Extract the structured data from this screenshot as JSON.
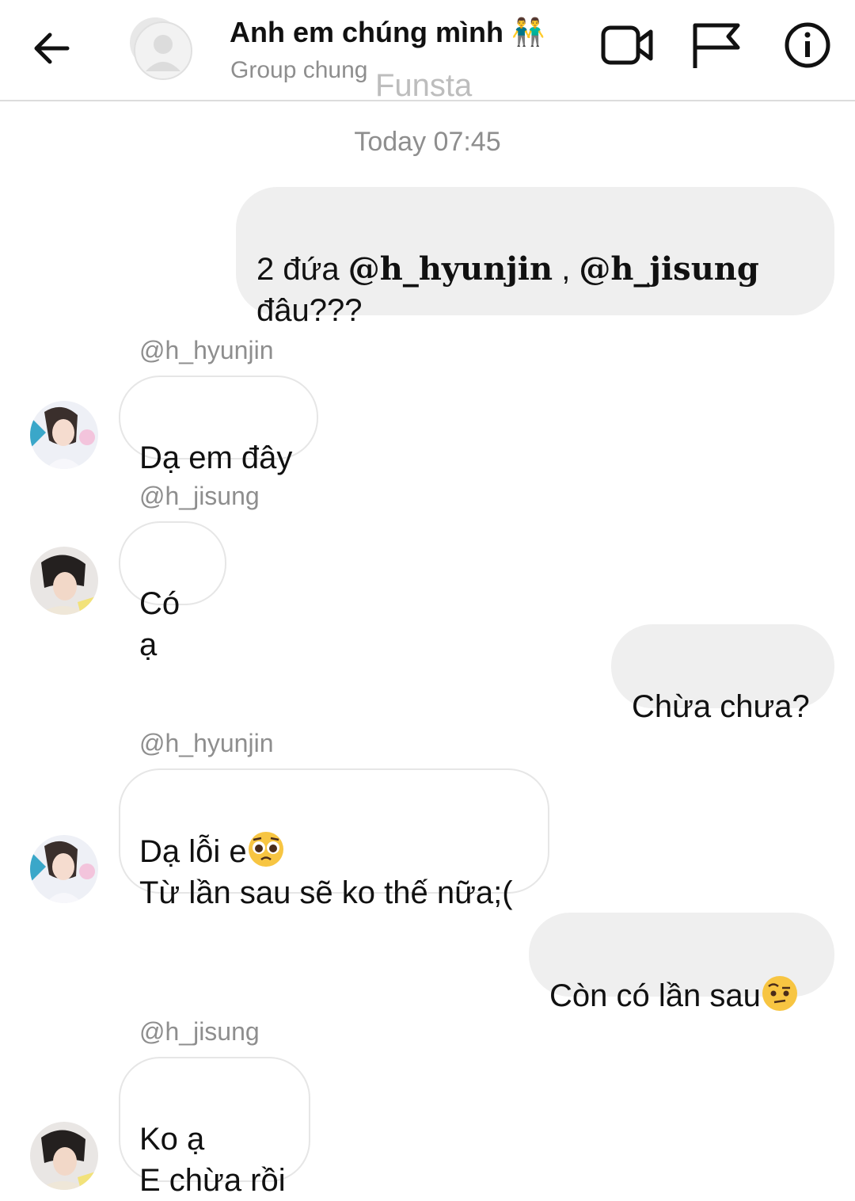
{
  "header": {
    "title": "Anh em chúng mình",
    "title_emoji": "👬",
    "subtitle": "Group chung",
    "watermark": "Funsta",
    "icons": [
      "back-arrow-icon",
      "group-avatar-icon",
      "video-call-icon",
      "flag-icon",
      "info-icon"
    ]
  },
  "chat": {
    "timestamp": "Today 07:45",
    "messages": [
      {
        "direction": "out",
        "text_before": "2 đứa ",
        "mention1": "@h_hyunjin",
        "middle": " , ",
        "mention2": "@h_jisung",
        "text_after": "đâu???"
      },
      {
        "direction": "in",
        "sender": "@h_hyunjin",
        "text": "Dạ em đây"
      },
      {
        "direction": "in",
        "sender": "@h_jisung",
        "text": "Có ạ"
      },
      {
        "direction": "out",
        "text": "Chừa chưa?"
      },
      {
        "direction": "in",
        "sender": "@h_hyunjin",
        "line1": "Dạ lỗi e",
        "line2": "Từ lần sau sẽ ko thế nữa;("
      },
      {
        "direction": "out",
        "text": "Còn có lần sau"
      },
      {
        "direction": "in",
        "sender": "@h_jisung",
        "line1": "Ko ạ",
        "line2": "E chừa rồi"
      }
    ]
  },
  "colors": {
    "outgoing_bubble": "#efefef",
    "incoming_border": "#e6e6e6",
    "meta_text": "#8e8e8e",
    "header_divider": "#dcdcdc"
  }
}
